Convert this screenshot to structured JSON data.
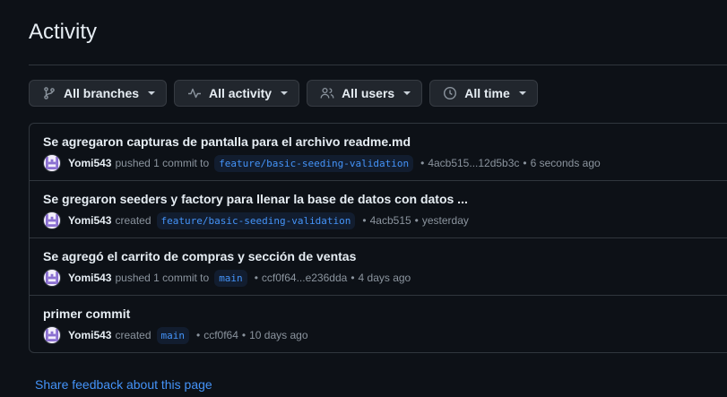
{
  "header": {
    "title": "Activity"
  },
  "filters": {
    "branches": {
      "label": "All branches",
      "icon": "git-branch-icon"
    },
    "activity": {
      "label": "All activity",
      "icon": "pulse-icon"
    },
    "users": {
      "label": "All users",
      "icon": "people-icon"
    },
    "time": {
      "label": "All time",
      "icon": "clock-icon"
    }
  },
  "activity_items": [
    {
      "title": "Se agregaron capturas de pantalla para el archivo readme.md",
      "user": "Yomi543",
      "action": "pushed 1 commit to",
      "branch": "feature/basic-seeding-validation",
      "commit": "4acb515...12d5b3c",
      "time": "6 seconds ago"
    },
    {
      "title": "Se gregaron seeders y factory para llenar la base de datos con datos ...",
      "user": "Yomi543",
      "action": "created",
      "branch": "feature/basic-seeding-validation",
      "commit": "4acb515",
      "time": "yesterday"
    },
    {
      "title": "Se agregó el carrito de compras y sección de ventas",
      "user": "Yomi543",
      "action": "pushed 1 commit to",
      "branch": "main",
      "commit": "ccf0f64...e236dda",
      "time": "4 days ago"
    },
    {
      "title": "primer commit",
      "user": "Yomi543",
      "action": "created",
      "branch": "main",
      "commit": "ccf0f64",
      "time": "10 days ago"
    }
  ],
  "footer": {
    "feedback_link": "Share feedback about this page"
  },
  "colors": {
    "background": "#0d1117",
    "border": "#30363d",
    "link": "#4493f8",
    "muted": "#8b949e",
    "text": "#e6edf3"
  }
}
